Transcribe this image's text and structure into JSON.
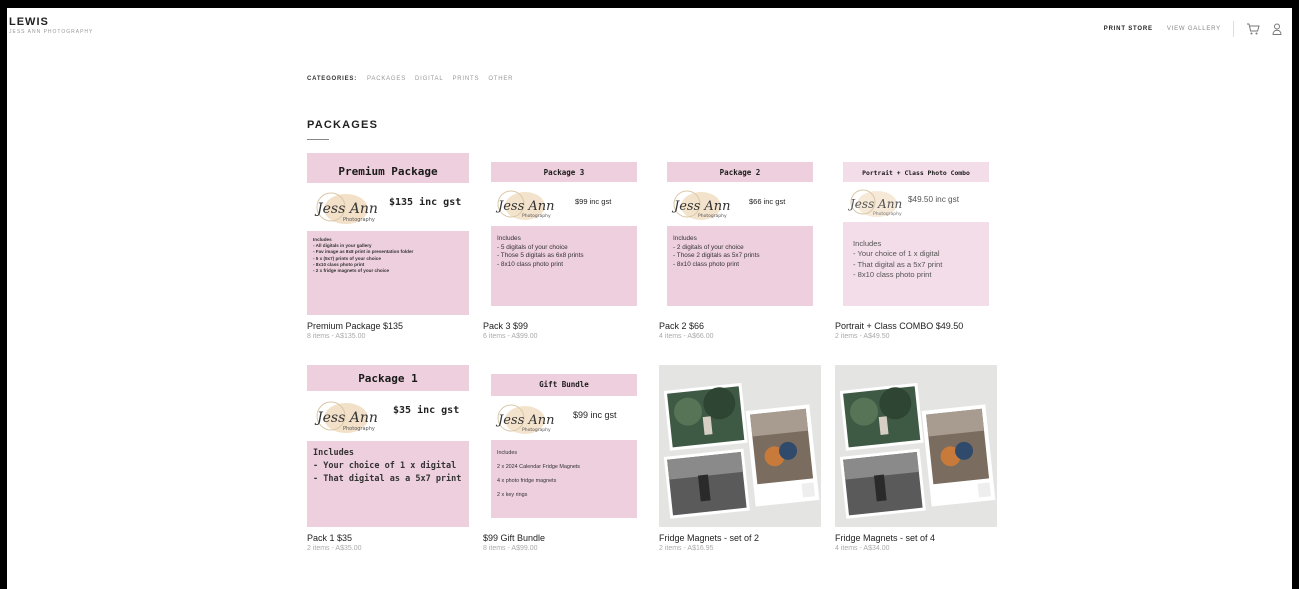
{
  "brand": {
    "title": "LEWIS",
    "subtitle": "JESS ANN PHOTOGRAPHY"
  },
  "nav": {
    "print_store": "PRINT STORE",
    "view_gallery": "VIEW GALLERY",
    "cart_icon": "cart-icon",
    "user_icon": "user-icon"
  },
  "categories": {
    "label": "CATEGORIES:",
    "items": [
      "PACKAGES",
      "DIGITAL",
      "PRINTS",
      "OTHER"
    ]
  },
  "section": {
    "title": "PACKAGES"
  },
  "logo_text": {
    "script": "Jess Ann",
    "small": "Photography"
  },
  "products": [
    {
      "title": "Premium Package $135",
      "meta": "8 items - A$135.00",
      "image": {
        "heading": "Premium Package",
        "price": "$135 inc gst",
        "includes": "Includes\n- All digitals in your gallery\n- Fav image as 8x8 print in presentation folder\n- 5 x (5x7) prints of your choice\n- 8x10 class photo print\n- 2 x fridge magnets of your choice"
      }
    },
    {
      "title": "Pack 3 $99",
      "meta": "6 items - A$99.00",
      "image": {
        "heading": "Package 3",
        "price": "$99 inc gst",
        "includes": "Includes\n- 5 digitals of your choice\n- Those 5 digitals as 6x8 prints\n- 8x10 class photo print"
      }
    },
    {
      "title": "Pack 2 $66",
      "meta": "4 items - A$66.00",
      "image": {
        "heading": "Package 2",
        "price": "$66 inc gst",
        "includes": "Includes\n- 2 digitals of your choice\n- Those 2 digitals as 5x7 prints\n- 8x10 class photo print"
      }
    },
    {
      "title": "Portrait + Class COMBO $49.50",
      "meta": "2 items - A$49.50",
      "image": {
        "heading": "Portrait + Class Photo Combo",
        "price": "$49.50 inc gst",
        "includes": "Includes\n- Your choice of 1 x digital\n- That digital as a 5x7 print\n- 8x10 class photo print"
      }
    },
    {
      "title": "Pack 1 $35",
      "meta": "2 items - A$35.00",
      "image": {
        "heading": "Package 1",
        "price": "$35 inc gst",
        "includes": "Includes\n- Your choice of 1 x digital\n- That digital as a 5x7 print"
      }
    },
    {
      "title": "$99 Gift Bundle",
      "meta": "8 items - A$99.00",
      "image": {
        "heading": "Gift Bundle",
        "price": "$99 inc gst",
        "includes": "Includes\n2 x 2024 Calendar Fridge Magnets\n4 x photo fridge magnets\n2 x key rings"
      }
    },
    {
      "title": "Fridge Magnets - set of 2",
      "meta": "2 items - A$16.95"
    },
    {
      "title": "Fridge Magnets - set of 4",
      "meta": "4 items - A$34.00"
    }
  ]
}
